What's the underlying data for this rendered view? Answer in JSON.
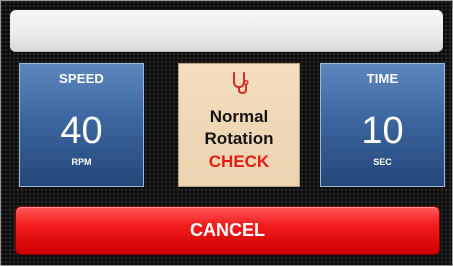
{
  "title_bar": {
    "text": ""
  },
  "speed": {
    "label": "SPEED",
    "value": "40",
    "unit": "RPM"
  },
  "status": {
    "icon": "stethoscope-icon",
    "line1": "Normal",
    "line2": "Rotation",
    "check": "CHECK"
  },
  "time": {
    "label": "TIME",
    "value": "10",
    "unit": "SEC"
  },
  "cancel": {
    "label": "CANCEL"
  },
  "colors": {
    "panel_blue": "#3c669f",
    "status_bg": "#ecd3b0",
    "check_red": "#e41b17",
    "cancel_red": "#e80f0f"
  }
}
